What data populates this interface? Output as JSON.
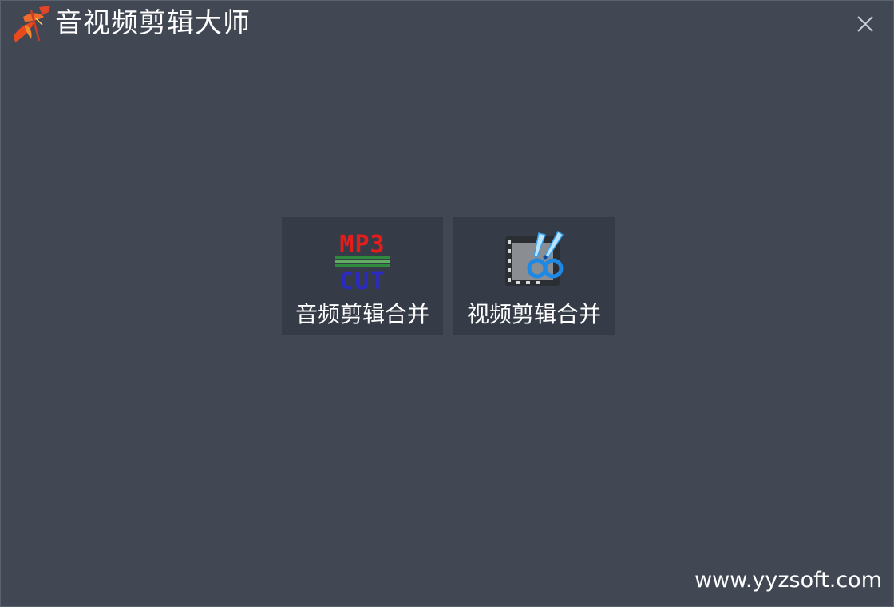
{
  "window": {
    "title": "音视频剪辑大师",
    "close_icon": "close-icon",
    "app_icon": "app-logo-icon",
    "colors": {
      "background": "#414854",
      "tile": "#363c47",
      "border": "#596270",
      "text": "#ffffff"
    }
  },
  "tiles": [
    {
      "label": "音频剪辑合并",
      "icon": "mp3-cut-icon",
      "icon_text_top": "MP3",
      "icon_text_bottom": "CUT"
    },
    {
      "label": "视频剪辑合并",
      "icon": "film-scissors-icon"
    }
  ],
  "footer": {
    "website": "www.yyzsoft.com"
  }
}
